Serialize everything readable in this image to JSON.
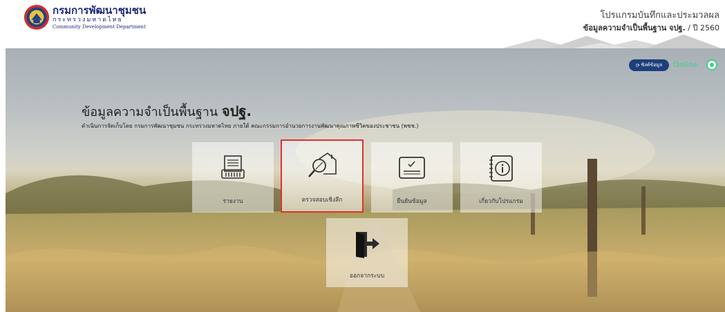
{
  "header": {
    "dept_name_th": "กรมการพัฒนาชุมชน",
    "ministry_th": "กระทรวงมหาดไทย",
    "dept_name_en": "Community Development Department",
    "program_title": "โปรแกรมบันทึกและประมวลผล",
    "program_sub_bold": "ข้อมูลความจำเป็นพื้นฐาน จปฐ.",
    "program_sub_year": " / ปี 2560"
  },
  "status": {
    "sync_label": "ซิงค์ข้อมูล",
    "online_label": "Online",
    "online_color": "#3ecf8e",
    "sync_color": "#1d3f7a"
  },
  "main": {
    "title_prefix": "ข้อมูลความจำเป็นพื้นฐาน ",
    "title_bold": "จปฐ.",
    "subtitle": "ดำเนินการจัดเก็บโดย กรมการพัฒนาชุมชน กระทรวงมหาดไทย ภายใต้ คณะกรรมการอำนวยการงานพัฒนาคุณภาพชีวิตของประชาชน (พชช.)"
  },
  "tiles": [
    {
      "label": "รายงาน",
      "icon": "report-icon"
    },
    {
      "label": "ตรวจสอบเชิงลึก",
      "icon": "house-search-icon",
      "highlighted": true,
      "highlight_color": "#e0312b"
    },
    {
      "label": "ยืนยันข้อมูล",
      "icon": "sign-confirm-icon"
    },
    {
      "label": "เกี่ยวกับโปรแกรม",
      "icon": "info-icon"
    },
    {
      "label": "ออกจากระบบ",
      "icon": "logout-door-icon"
    }
  ]
}
